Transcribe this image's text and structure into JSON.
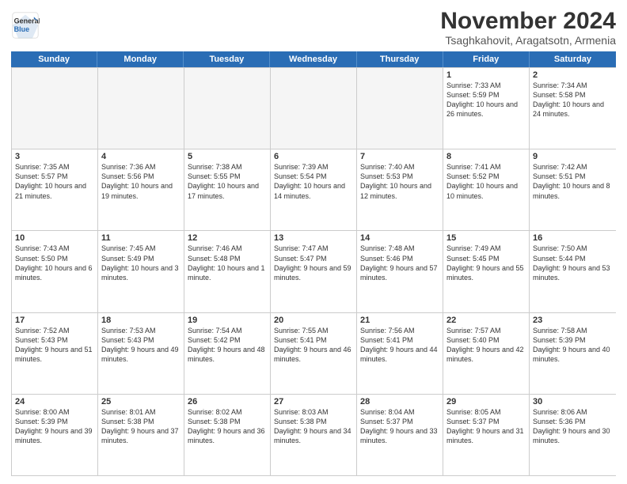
{
  "logo": {
    "general": "General",
    "blue": "Blue"
  },
  "title": "November 2024",
  "subtitle": "Tsaghkahovit, Aragatsotn, Armenia",
  "days": [
    "Sunday",
    "Monday",
    "Tuesday",
    "Wednesday",
    "Thursday",
    "Friday",
    "Saturday"
  ],
  "rows": [
    [
      {
        "day": "",
        "text": "",
        "empty": true
      },
      {
        "day": "",
        "text": "",
        "empty": true
      },
      {
        "day": "",
        "text": "",
        "empty": true
      },
      {
        "day": "",
        "text": "",
        "empty": true
      },
      {
        "day": "",
        "text": "",
        "empty": true
      },
      {
        "day": "1",
        "text": "Sunrise: 7:33 AM\nSunset: 5:59 PM\nDaylight: 10 hours and 26 minutes."
      },
      {
        "day": "2",
        "text": "Sunrise: 7:34 AM\nSunset: 5:58 PM\nDaylight: 10 hours and 24 minutes."
      }
    ],
    [
      {
        "day": "3",
        "text": "Sunrise: 7:35 AM\nSunset: 5:57 PM\nDaylight: 10 hours and 21 minutes."
      },
      {
        "day": "4",
        "text": "Sunrise: 7:36 AM\nSunset: 5:56 PM\nDaylight: 10 hours and 19 minutes."
      },
      {
        "day": "5",
        "text": "Sunrise: 7:38 AM\nSunset: 5:55 PM\nDaylight: 10 hours and 17 minutes."
      },
      {
        "day": "6",
        "text": "Sunrise: 7:39 AM\nSunset: 5:54 PM\nDaylight: 10 hours and 14 minutes."
      },
      {
        "day": "7",
        "text": "Sunrise: 7:40 AM\nSunset: 5:53 PM\nDaylight: 10 hours and 12 minutes."
      },
      {
        "day": "8",
        "text": "Sunrise: 7:41 AM\nSunset: 5:52 PM\nDaylight: 10 hours and 10 minutes."
      },
      {
        "day": "9",
        "text": "Sunrise: 7:42 AM\nSunset: 5:51 PM\nDaylight: 10 hours and 8 minutes."
      }
    ],
    [
      {
        "day": "10",
        "text": "Sunrise: 7:43 AM\nSunset: 5:50 PM\nDaylight: 10 hours and 6 minutes."
      },
      {
        "day": "11",
        "text": "Sunrise: 7:45 AM\nSunset: 5:49 PM\nDaylight: 10 hours and 3 minutes."
      },
      {
        "day": "12",
        "text": "Sunrise: 7:46 AM\nSunset: 5:48 PM\nDaylight: 10 hours and 1 minute."
      },
      {
        "day": "13",
        "text": "Sunrise: 7:47 AM\nSunset: 5:47 PM\nDaylight: 9 hours and 59 minutes."
      },
      {
        "day": "14",
        "text": "Sunrise: 7:48 AM\nSunset: 5:46 PM\nDaylight: 9 hours and 57 minutes."
      },
      {
        "day": "15",
        "text": "Sunrise: 7:49 AM\nSunset: 5:45 PM\nDaylight: 9 hours and 55 minutes."
      },
      {
        "day": "16",
        "text": "Sunrise: 7:50 AM\nSunset: 5:44 PM\nDaylight: 9 hours and 53 minutes."
      }
    ],
    [
      {
        "day": "17",
        "text": "Sunrise: 7:52 AM\nSunset: 5:43 PM\nDaylight: 9 hours and 51 minutes."
      },
      {
        "day": "18",
        "text": "Sunrise: 7:53 AM\nSunset: 5:43 PM\nDaylight: 9 hours and 49 minutes."
      },
      {
        "day": "19",
        "text": "Sunrise: 7:54 AM\nSunset: 5:42 PM\nDaylight: 9 hours and 48 minutes."
      },
      {
        "day": "20",
        "text": "Sunrise: 7:55 AM\nSunset: 5:41 PM\nDaylight: 9 hours and 46 minutes."
      },
      {
        "day": "21",
        "text": "Sunrise: 7:56 AM\nSunset: 5:41 PM\nDaylight: 9 hours and 44 minutes."
      },
      {
        "day": "22",
        "text": "Sunrise: 7:57 AM\nSunset: 5:40 PM\nDaylight: 9 hours and 42 minutes."
      },
      {
        "day": "23",
        "text": "Sunrise: 7:58 AM\nSunset: 5:39 PM\nDaylight: 9 hours and 40 minutes."
      }
    ],
    [
      {
        "day": "24",
        "text": "Sunrise: 8:00 AM\nSunset: 5:39 PM\nDaylight: 9 hours and 39 minutes."
      },
      {
        "day": "25",
        "text": "Sunrise: 8:01 AM\nSunset: 5:38 PM\nDaylight: 9 hours and 37 minutes."
      },
      {
        "day": "26",
        "text": "Sunrise: 8:02 AM\nSunset: 5:38 PM\nDaylight: 9 hours and 36 minutes."
      },
      {
        "day": "27",
        "text": "Sunrise: 8:03 AM\nSunset: 5:38 PM\nDaylight: 9 hours and 34 minutes."
      },
      {
        "day": "28",
        "text": "Sunrise: 8:04 AM\nSunset: 5:37 PM\nDaylight: 9 hours and 33 minutes."
      },
      {
        "day": "29",
        "text": "Sunrise: 8:05 AM\nSunset: 5:37 PM\nDaylight: 9 hours and 31 minutes."
      },
      {
        "day": "30",
        "text": "Sunrise: 8:06 AM\nSunset: 5:36 PM\nDaylight: 9 hours and 30 minutes."
      }
    ]
  ]
}
